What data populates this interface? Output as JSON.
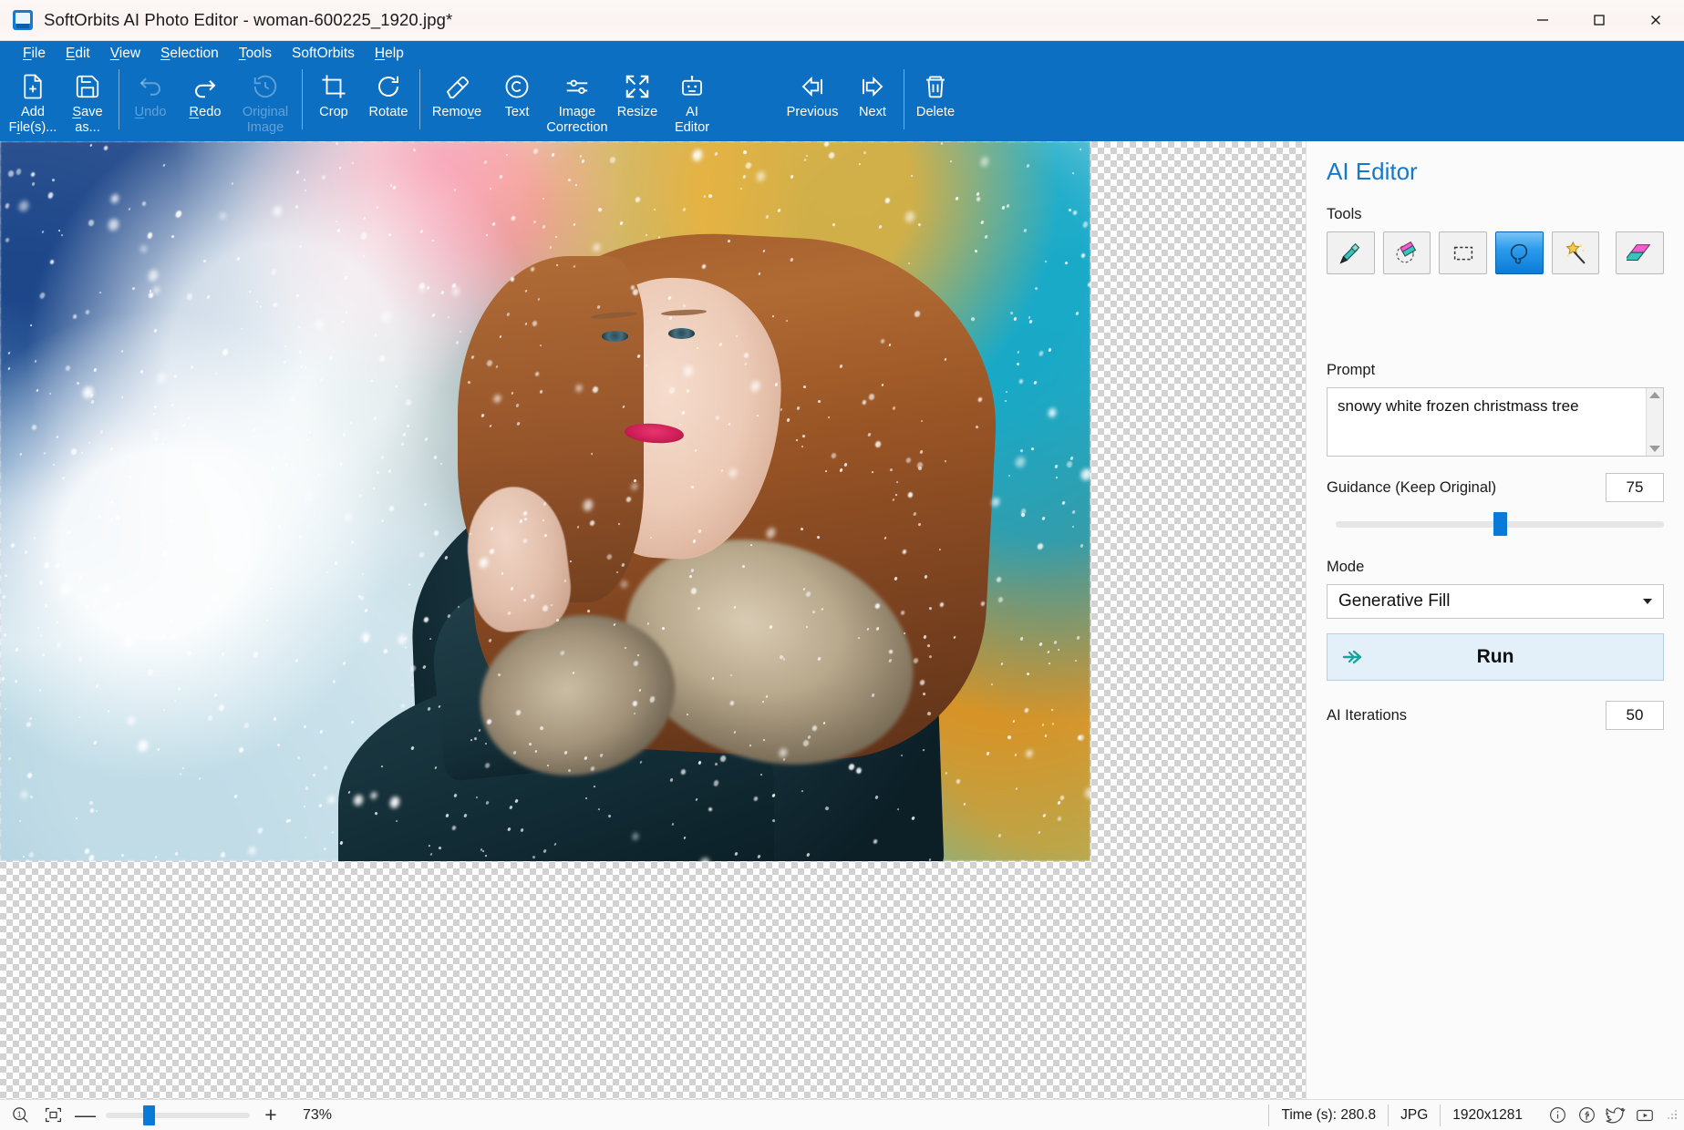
{
  "window": {
    "title": "SoftOrbits AI Photo Editor - woman-600225_1920.jpg*",
    "app_icon": "app-logo-icon",
    "minimize_label": "minimize-icon",
    "maximize_label": "maximize-icon",
    "close_label": "close-icon"
  },
  "menu": {
    "items": [
      {
        "label": "File",
        "accel": "F"
      },
      {
        "label": "Edit",
        "accel": "E"
      },
      {
        "label": "View",
        "accel": "V"
      },
      {
        "label": "Selection",
        "accel": "S"
      },
      {
        "label": "Tools",
        "accel": "T"
      },
      {
        "label": "SoftOrbits",
        "accel": ""
      },
      {
        "label": "Help",
        "accel": "H"
      }
    ]
  },
  "toolbar": {
    "buttons": [
      {
        "id": "add-files",
        "line1": "Add",
        "line2": "File(s)...",
        "icon": "file-plus-icon",
        "enabled": true
      },
      {
        "id": "save-as",
        "line1": "Save",
        "line2": "as...",
        "icon": "save-icon",
        "enabled": true
      },
      {
        "id": "undo",
        "line1": "Undo",
        "line2": "",
        "icon": "undo-arrow-icon",
        "enabled": false
      },
      {
        "id": "redo",
        "line1": "Redo",
        "line2": "",
        "icon": "redo-arrow-icon",
        "enabled": true
      },
      {
        "id": "original-image",
        "line1": "Original",
        "line2": "Image",
        "icon": "history-clock-icon",
        "enabled": false
      },
      {
        "id": "crop",
        "line1": "Crop",
        "line2": "",
        "icon": "crop-icon",
        "enabled": true
      },
      {
        "id": "rotate",
        "line1": "Rotate",
        "line2": "",
        "icon": "rotate-cw-icon",
        "enabled": true
      },
      {
        "id": "remove",
        "line1": "Remove",
        "line2": "",
        "icon": "eraser-icon",
        "enabled": true
      },
      {
        "id": "text",
        "line1": "Text",
        "line2": "",
        "icon": "copyright-c-icon",
        "enabled": true
      },
      {
        "id": "image-correction",
        "line1": "Image",
        "line2": "Correction",
        "icon": "sliders-icon",
        "enabled": true
      },
      {
        "id": "resize",
        "line1": "Resize",
        "line2": "",
        "icon": "expand-arrows-icon",
        "enabled": true
      },
      {
        "id": "ai-editor",
        "line1": "AI",
        "line2": "Editor",
        "icon": "robot-icon",
        "enabled": true
      },
      {
        "id": "previous",
        "line1": "Previous",
        "line2": "",
        "icon": "arrow-left-bar-icon",
        "enabled": true
      },
      {
        "id": "next",
        "line1": "Next",
        "line2": "",
        "icon": "arrow-right-bar-icon",
        "enabled": true
      },
      {
        "id": "delete",
        "line1": "Delete",
        "line2": "",
        "icon": "trash-icon",
        "enabled": true
      }
    ]
  },
  "panel": {
    "title": "AI Editor",
    "tools_label": "Tools",
    "tools": [
      {
        "id": "brush",
        "icon": "brush-icon",
        "active": false
      },
      {
        "id": "eraser-selection",
        "icon": "eraser-circle-icon",
        "active": false
      },
      {
        "id": "rect-select",
        "icon": "rectangle-select-icon",
        "active": false
      },
      {
        "id": "lasso-select",
        "icon": "lasso-icon",
        "active": true
      },
      {
        "id": "magic-wand",
        "icon": "magic-wand-icon",
        "active": false
      },
      {
        "id": "fill-shape",
        "icon": "parallelogram-icon",
        "active": false
      }
    ],
    "prompt_label": "Prompt",
    "prompt_value": "snowy white frozen christmass tree",
    "prompt_scroll_up": "scroll-up-arrow-icon",
    "prompt_scroll_down": "scroll-down-arrow-icon",
    "guidance_label": "Guidance (Keep Original)",
    "guidance_value": "75",
    "guidance_percent": 50,
    "mode_label": "Mode",
    "mode_value": "Generative Fill",
    "run_label": "Run",
    "run_icon": "double-arrow-right-icon",
    "iterations_label": "AI Iterations",
    "iterations_value": "50"
  },
  "statusbar": {
    "zoom_actual_icon": "zoom-actual-size-icon",
    "zoom_fit_icon": "zoom-fit-screen-icon",
    "zoom_out_label": "—",
    "zoom_in_label": "+",
    "zoom_percent_label": "73%",
    "zoom_slider_percent": 30,
    "time_label": "Time (s): 280.8",
    "format_label": "JPG",
    "dimensions_label": "1920x1281",
    "social": [
      {
        "id": "info",
        "icon": "info-circle-icon"
      },
      {
        "id": "facebook",
        "icon": "facebook-icon"
      },
      {
        "id": "twitter",
        "icon": "twitter-bird-icon"
      },
      {
        "id": "youtube",
        "icon": "youtube-icon"
      }
    ]
  },
  "colors": {
    "accent_blue": "#0d6fc2",
    "panel_title_blue": "#1878c8",
    "slider_blue": "#0a7ad8",
    "run_bg": "#e3f0fa",
    "titlebar_bg": "#fdf7f5"
  }
}
